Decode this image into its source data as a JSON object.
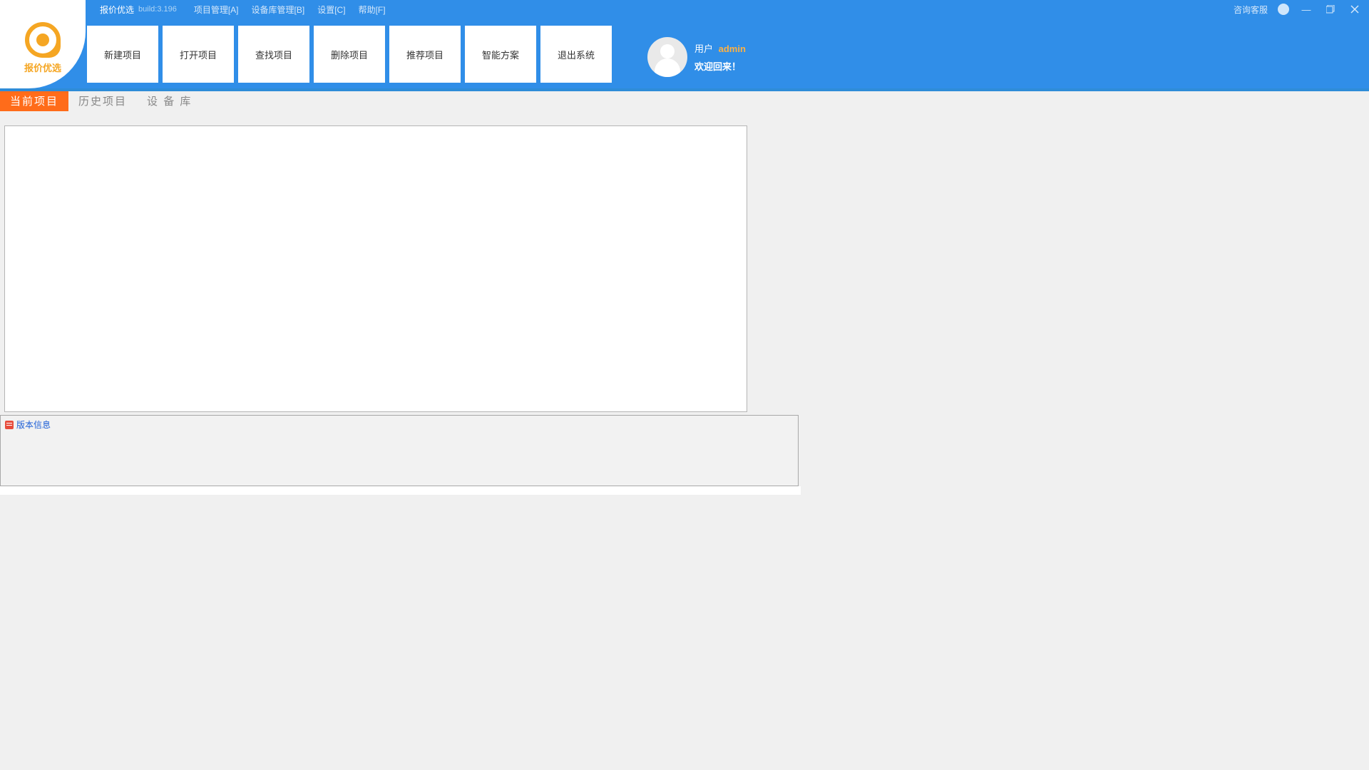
{
  "menubar": {
    "title": "报价优选",
    "build": "build:3.196",
    "items": [
      "项目管理[A]",
      "设备库管理[B]",
      "设置[C]",
      "帮助[F]"
    ],
    "support": "咨询客服"
  },
  "logo": {
    "text": "报价优选"
  },
  "toolbar": {
    "buttons": [
      "新建项目",
      "打开项目",
      "查找项目",
      "删除项目",
      "推荐项目",
      "智能方案",
      "退出系统"
    ]
  },
  "user": {
    "label": "用户",
    "name": "admin",
    "welcome": "欢迎回来！"
  },
  "tabs": {
    "items": [
      "当前项目",
      "历史项目",
      "设 备 库"
    ],
    "activeIndex": 0
  },
  "versionPanel": {
    "title": "版本信息"
  }
}
